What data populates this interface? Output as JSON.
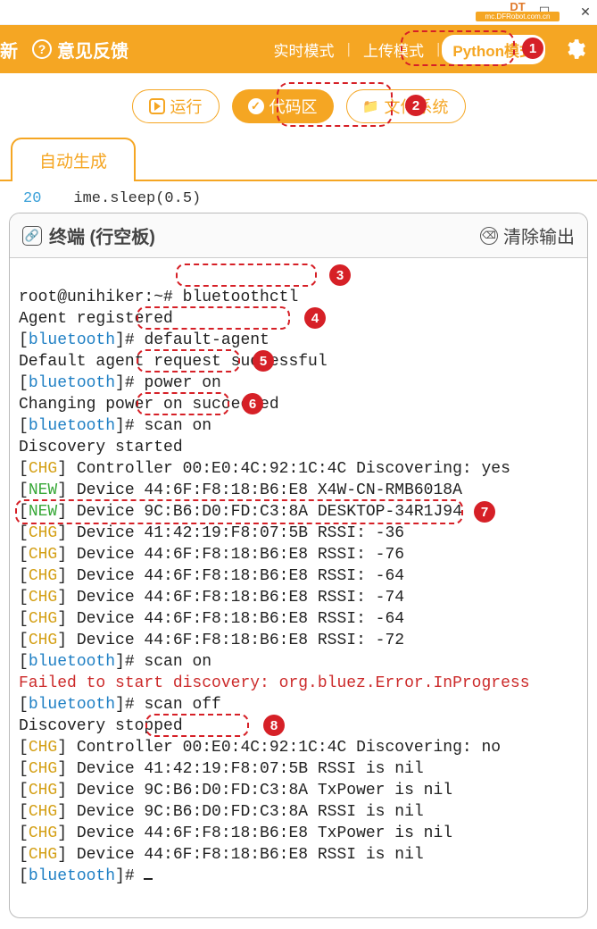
{
  "titlebar": {
    "logo_text": "DT",
    "logo_sub": "mc.DFRobot.com.cn"
  },
  "header": {
    "refresh_label": "新",
    "feedback_label": "意见反馈",
    "modes": {
      "realtime": "实时模式",
      "upload": "上传模式",
      "python": "Python模式"
    }
  },
  "toolbar": {
    "run_label": "运行",
    "code_label": "代码区",
    "filesys_label": "文件系统"
  },
  "tab": {
    "autogen": "自动生成"
  },
  "code_snippet": {
    "line_no": "20",
    "text": "  ime.sleep(0.5)"
  },
  "panel": {
    "title": "终端 (行空板)",
    "clear_label": "清除输出"
  },
  "badges": {
    "b1": "1",
    "b2": "2",
    "b3": "3",
    "b4": "4",
    "b5": "5",
    "b6": "6",
    "b7": "7",
    "b8": "8"
  },
  "terminal": {
    "l01_a": "root@unihiker:~# ",
    "l01_b": "bluetoothctl",
    "l02": "Agent registered",
    "l03_a": "[",
    "l03_b": "bluetooth",
    "l03_c": "]# ",
    "l03_d": "default-agent",
    "l04": "Default agent request successful",
    "l05_a": "[",
    "l05_b": "bluetooth",
    "l05_c": "]# ",
    "l05_d": "power on",
    "l06": "Changing power on succeeded",
    "l07_a": "[",
    "l07_b": "bluetooth",
    "l07_c": "]# ",
    "l07_d": "scan on",
    "l08": "Discovery started",
    "l09_a": "[",
    "l09_b": "CHG",
    "l09_c": "] Controller 00:E0:4C:92:1C:4C Discovering: yes",
    "l10_a": "[",
    "l10_b": "NEW",
    "l10_c": "] Device 44:6F:F8:18:B6:E8 X4W-CN-RMB6018A",
    "l11_a": "[",
    "l11_b": "NEW",
    "l11_c": "] Device 9C:B6:D0:FD:C3:8A DESKTOP-34R1J94",
    "l12_a": "[",
    "l12_b": "CHG",
    "l12_c": "] Device 41:42:19:F8:07:5B RSSI: -36",
    "l13_a": "[",
    "l13_b": "CHG",
    "l13_c": "] Device 44:6F:F8:18:B6:E8 RSSI: -76",
    "l14_a": "[",
    "l14_b": "CHG",
    "l14_c": "] Device 44:6F:F8:18:B6:E8 RSSI: -64",
    "l15_a": "[",
    "l15_b": "CHG",
    "l15_c": "] Device 44:6F:F8:18:B6:E8 RSSI: -74",
    "l16_a": "[",
    "l16_b": "CHG",
    "l16_c": "] Device 44:6F:F8:18:B6:E8 RSSI: -64",
    "l17_a": "[",
    "l17_b": "CHG",
    "l17_c": "] Device 44:6F:F8:18:B6:E8 RSSI: -72",
    "l18_a": "[",
    "l18_b": "bluetooth",
    "l18_c": "]# scan on",
    "l19": "Failed to start discovery: org.bluez.Error.InProgress",
    "l20_a": "[",
    "l20_b": "bluetooth",
    "l20_c": "]# ",
    "l20_d": "scan off",
    "l21": "Discovery stopped",
    "l22_a": "[",
    "l22_b": "CHG",
    "l22_c": "] Controller 00:E0:4C:92:1C:4C Discovering: no",
    "l23_a": "[",
    "l23_b": "CHG",
    "l23_c": "] Device 41:42:19:F8:07:5B RSSI is nil",
    "l24_a": "[",
    "l24_b": "CHG",
    "l24_c": "] Device 9C:B6:D0:FD:C3:8A TxPower is nil",
    "l25_a": "[",
    "l25_b": "CHG",
    "l25_c": "] Device 9C:B6:D0:FD:C3:8A RSSI is nil",
    "l26_a": "[",
    "l26_b": "CHG",
    "l26_c": "] Device 44:6F:F8:18:B6:E8 TxPower is nil",
    "l27_a": "[",
    "l27_b": "CHG",
    "l27_c": "] Device 44:6F:F8:18:B6:E8 RSSI is nil",
    "l28_a": "[",
    "l28_b": "bluetooth",
    "l28_c": "]# "
  }
}
